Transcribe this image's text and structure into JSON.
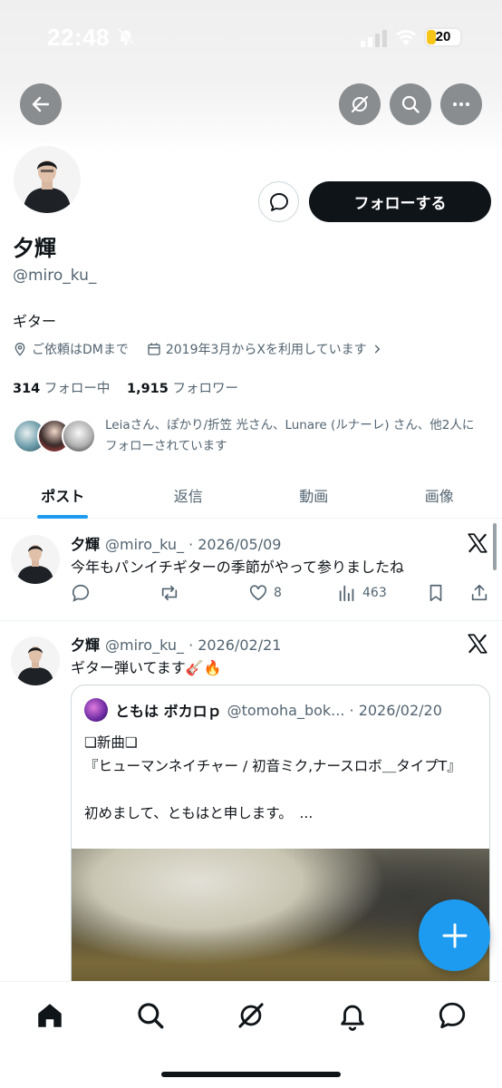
{
  "status_bar": {
    "time": "22:48",
    "battery": "20"
  },
  "profile": {
    "display_name": "夕輝",
    "handle": "@miro_ku_",
    "bio": "ギター",
    "location": "ご依頼はDMまで",
    "joined": "2019年3月からXを利用しています",
    "following_count": "314",
    "following_label": "フォロー中",
    "followers_count": "1,915",
    "followers_label": "フォロワー",
    "followed_by_text": "Leiaさん、ぽかり/折笠 光さん、Lunare (ルナーレ) さん、他2人にフォローされています",
    "follow_button": "フォローする"
  },
  "tabs": [
    {
      "label": "ポスト",
      "active": true
    },
    {
      "label": "返信",
      "active": false
    },
    {
      "label": "動画",
      "active": false
    },
    {
      "label": "画像",
      "active": false
    }
  ],
  "posts": [
    {
      "name": "夕輝",
      "meta": "@miro_ku_ · 2026/05/09",
      "text": "今年もパンイチギターの季節がやって参りましたね",
      "likes": "8",
      "views": "463"
    },
    {
      "name": "夕輝",
      "meta": "@miro_ku_ · 2026/02/21",
      "text": "ギター弾いてます🎸🔥",
      "quote": {
        "name": "ともは ボカロｐ",
        "meta": "@tomoha_bok... · 2026/02/20",
        "line1": "❏新曲❏",
        "line2": "『ヒューマンネイチャー / 初音ミク,ナースロボ＿タイプT』",
        "line3": "初めまして、ともはと申します。　...",
        "image": "blurred music video thumbnail"
      }
    }
  ],
  "icons": {
    "back": "arrow-left-icon",
    "grok": "grok-icon",
    "search": "search-icon",
    "more": "more-icon",
    "x_logo": "x-logo-icon"
  },
  "colors": {
    "accent": "#1d9bf0",
    "text": "#0f1419",
    "secondary": "#536471",
    "follow_btn": "#0f1419"
  }
}
